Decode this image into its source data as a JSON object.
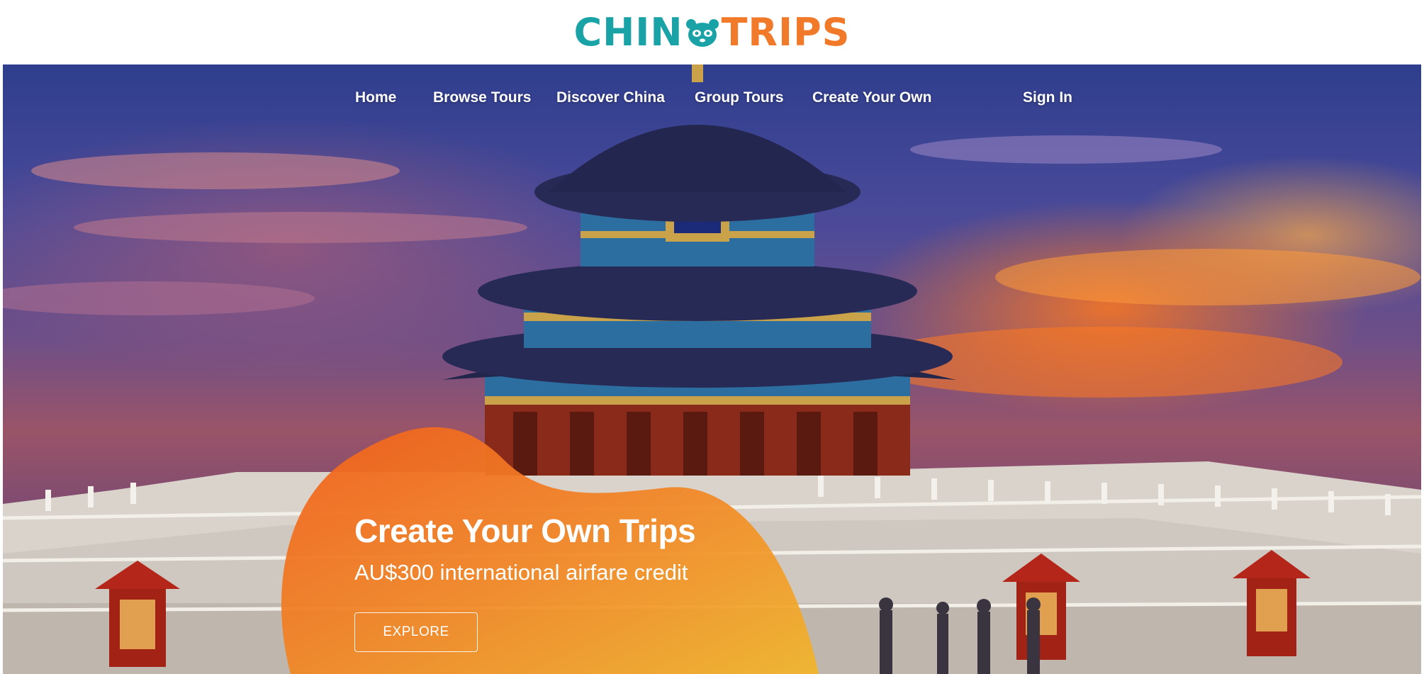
{
  "brand": {
    "logo_left": "CHIN",
    "logo_right": "TRIPS",
    "logo_icon": "panda-icon",
    "colors": {
      "teal": "#1aa3a7",
      "orange": "#f07a2a"
    }
  },
  "nav": {
    "items": [
      {
        "label": "Home"
      },
      {
        "label": "Browse Tours"
      },
      {
        "label": "Discover China"
      },
      {
        "label": "Group Tours"
      },
      {
        "label": "Create Your Own"
      }
    ],
    "sign_in": "Sign In"
  },
  "promo": {
    "title": "Create Your Own Trips",
    "subtitle": "AU$300 international airfare credit",
    "button": "EXPLORE",
    "colors": {
      "blob_top": "#f0601e",
      "blob_bottom": "#f2b52a"
    }
  }
}
